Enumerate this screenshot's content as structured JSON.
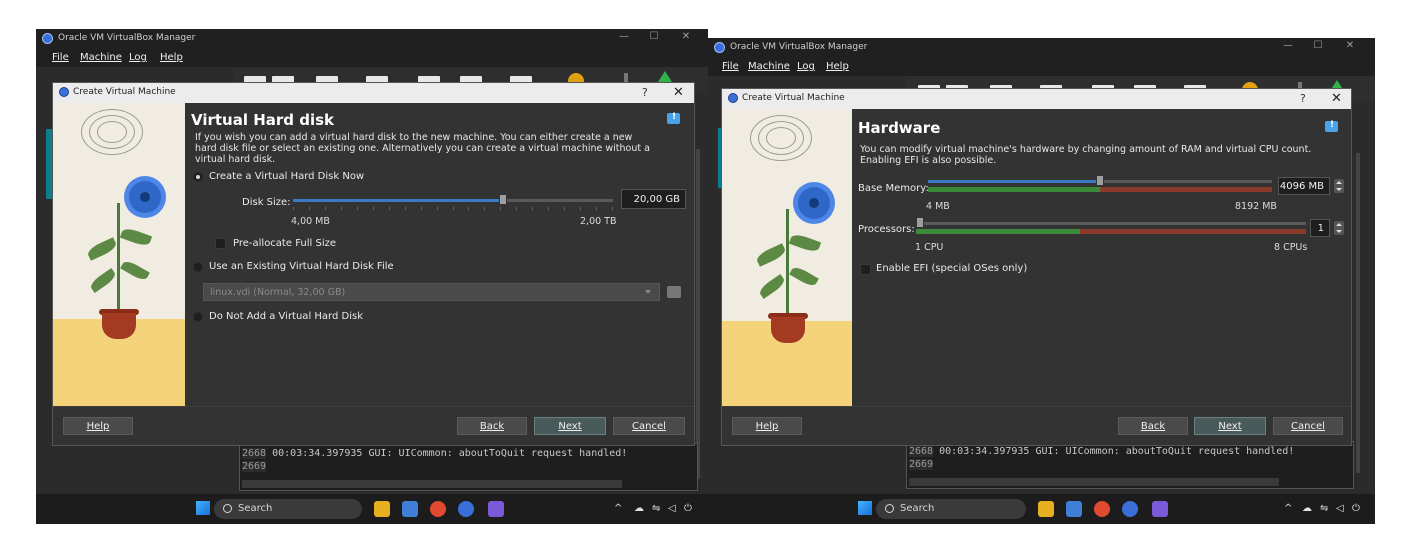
{
  "manager": {
    "title": "Oracle VM VirtualBox Manager",
    "menu": [
      "File",
      "Machine",
      "Log",
      "Help"
    ],
    "window_controls": {
      "minimize": "—",
      "maximize": "☐",
      "close": "✕"
    }
  },
  "dialog": {
    "title": "Create Virtual Machine",
    "help_glyph": "?",
    "close_glyph": "✕"
  },
  "left": {
    "page_title": "Virtual Hard disk",
    "description": [
      "If you wish you can add a virtual hard disk to the new machine. You can either create a new",
      "hard disk file or select an existing one. Alternatively you can create a virtual machine without a",
      "virtual hard disk."
    ],
    "option_create": "Create a Virtual Hard Disk Now",
    "disk_size_label": "Disk Size:",
    "disk_size_value": "20,00 GB",
    "disk_min": "4,00 MB",
    "disk_max": "2,00 TB",
    "disk_slider_fraction": 0.66,
    "preallocate": "Pre-allocate Full Size",
    "option_existing": "Use an Existing Virtual Hard Disk File",
    "existing_file": "linux.vdi (Normal, 32,00 GB)",
    "option_none": "Do Not Add a Virtual Hard Disk",
    "selected_option": "create"
  },
  "right": {
    "page_title": "Hardware",
    "description": [
      "You can modify virtual machine's hardware by changing amount of RAM and virtual CPU count.",
      "Enabling EFI is also possible."
    ],
    "memory_label": "Base Memory:",
    "memory_value": "4096",
    "memory_unit": "MB",
    "memory_min": "4 MB",
    "memory_max": "8192 MB",
    "memory_fraction": 0.5,
    "processors_label": "Processors:",
    "processors_value": "1",
    "cpu_min": "1 CPU",
    "cpu_max": "8 CPUs",
    "cpu_fraction": 0.0,
    "efi_label": "Enable EFI (special OSes only)"
  },
  "buttons": {
    "help": "Help",
    "back": "Back",
    "next": "Next",
    "cancel": "Cancel"
  },
  "log": {
    "lines": [
      {
        "num": "2668",
        "text": " 00:03:34.397935 GUI: UICommon: aboutToQuit request handled!"
      },
      {
        "num": "2669",
        "text": ""
      }
    ]
  },
  "taskbar": {
    "search_label": "Search",
    "tray_chevron": "^"
  },
  "colors": {
    "accent": "#0e7e8c",
    "slider_fill": "#3a7ac2",
    "range_green": "#3a8a3a",
    "range_red": "#8a3a2a"
  }
}
